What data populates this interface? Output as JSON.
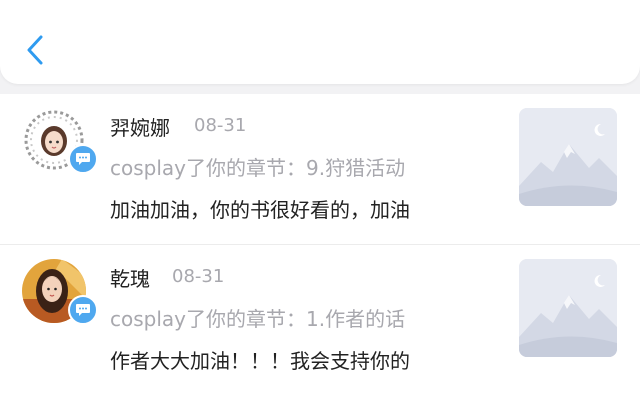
{
  "header": {
    "back_icon": "chevron-left-icon",
    "accent": "#2f9bf0"
  },
  "comments": [
    {
      "name": "羿婉娜",
      "date": "08-31",
      "action": "cosplay了你的章节：9.狩猎活动",
      "content": "加油加油，你的书很好看的，加油",
      "badge_icon": "comment-bubble-icon",
      "thumb_icon": "image-placeholder-icon"
    },
    {
      "name": "乾瑰",
      "date": "08-31",
      "action": "cosplay了你的章节：1.作者的话",
      "content": "作者大大加油！！！我会支持你的",
      "badge_icon": "comment-bubble-icon",
      "thumb_icon": "image-placeholder-icon"
    }
  ]
}
